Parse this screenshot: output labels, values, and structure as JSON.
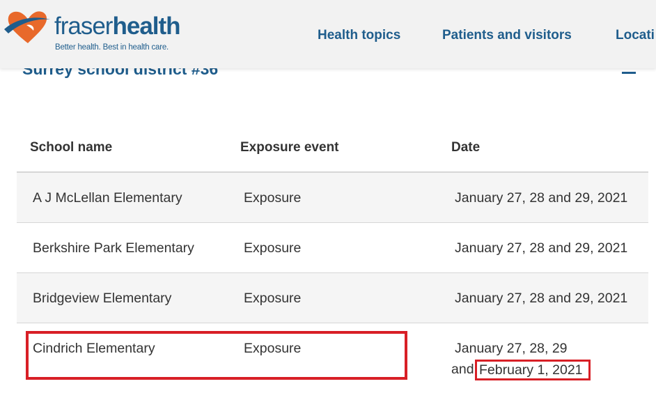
{
  "header": {
    "logo": {
      "word_light": "fraser",
      "word_bold": "health",
      "tagline": "Better health. Best in health care."
    },
    "nav": [
      {
        "label": "Health topics"
      },
      {
        "label": "Patients and visitors"
      },
      {
        "label": "Locati"
      }
    ]
  },
  "section": {
    "title": "Surrey school district #36"
  },
  "table": {
    "columns": [
      "School name",
      "Exposure event",
      "Date"
    ],
    "rows": [
      {
        "school": "A J McLellan Elementary",
        "event": "Exposure",
        "date": "January 27, 28 and 29, 2021"
      },
      {
        "school": "Berkshire Park Elementary",
        "event": "Exposure",
        "date": "January 27, 28 and 29, 2021"
      },
      {
        "school": "Bridgeview Elementary",
        "event": "Exposure",
        "date": "January 27, 28 and 29, 2021"
      },
      {
        "school": "Cindrich Elementary",
        "event": "Exposure",
        "date_line1": "January 27, 28, 29",
        "date_line2_prefix": "and",
        "date_highlight": "February 1,  2021"
      }
    ]
  },
  "colors": {
    "brand_blue": "#1f5d8c",
    "logo_orange": "#e8692b",
    "annotation_red": "#d81f26",
    "header_bg": "#f2f2f2",
    "row_shade": "#f5f5f5"
  },
  "icons": {
    "logo_mark": "heart-logo-icon",
    "collapse": "minus-icon"
  }
}
